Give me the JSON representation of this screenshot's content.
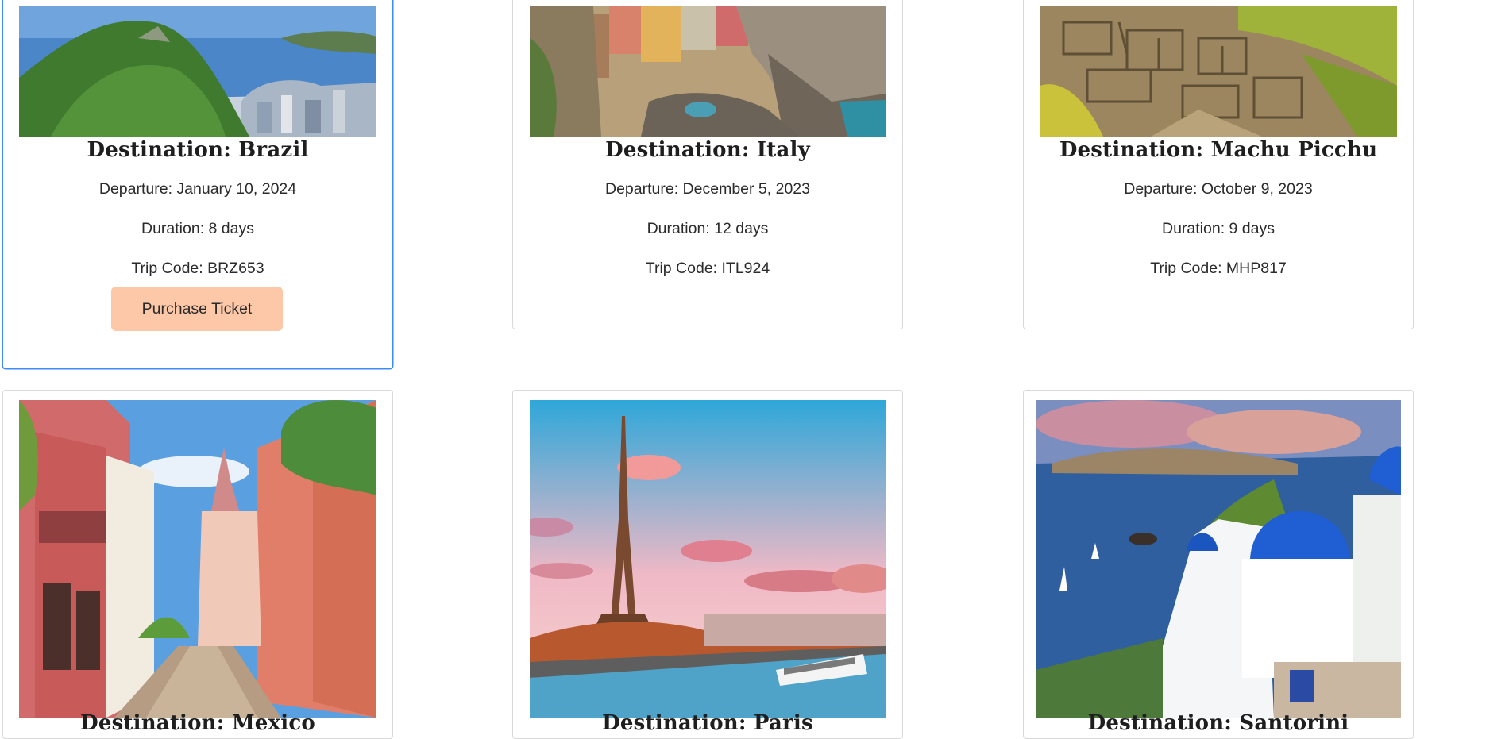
{
  "labels": {
    "destination_prefix": "Destination: ",
    "departure_prefix": "Departure: ",
    "duration_prefix": "Duration: ",
    "trip_code_prefix": "Trip Code: "
  },
  "cards": [
    {
      "destination": "Destination: Brazil",
      "departure": "Departure: January 10, 2024",
      "duration": "Duration: 8 days",
      "trip_code": "Trip Code: BRZ653",
      "button_label": "Purchase Ticket",
      "image_icon": "rio-de-janeiro-photo"
    },
    {
      "destination": "Destination: Italy",
      "departure": "Departure: December 5, 2023",
      "duration": "Duration: 12 days",
      "trip_code": "Trip Code: ITL924",
      "image_icon": "cinque-terre-photo"
    },
    {
      "destination": "Destination: Machu Picchu",
      "departure": "Departure: October 9, 2023",
      "duration": "Duration: 9 days",
      "trip_code": "Trip Code: MHP817",
      "image_icon": "machu-picchu-photo"
    },
    {
      "destination": "Destination: Mexico",
      "image_icon": "mexico-street-photo"
    },
    {
      "destination": "Destination: Paris",
      "image_icon": "eiffel-tower-photo"
    },
    {
      "destination": "Destination: Santorini",
      "image_icon": "santorini-photo"
    }
  ],
  "colors": {
    "button_bg": "#fcc8a8",
    "active_border": "#3d8bfd",
    "card_border": "#d9d9d9"
  }
}
